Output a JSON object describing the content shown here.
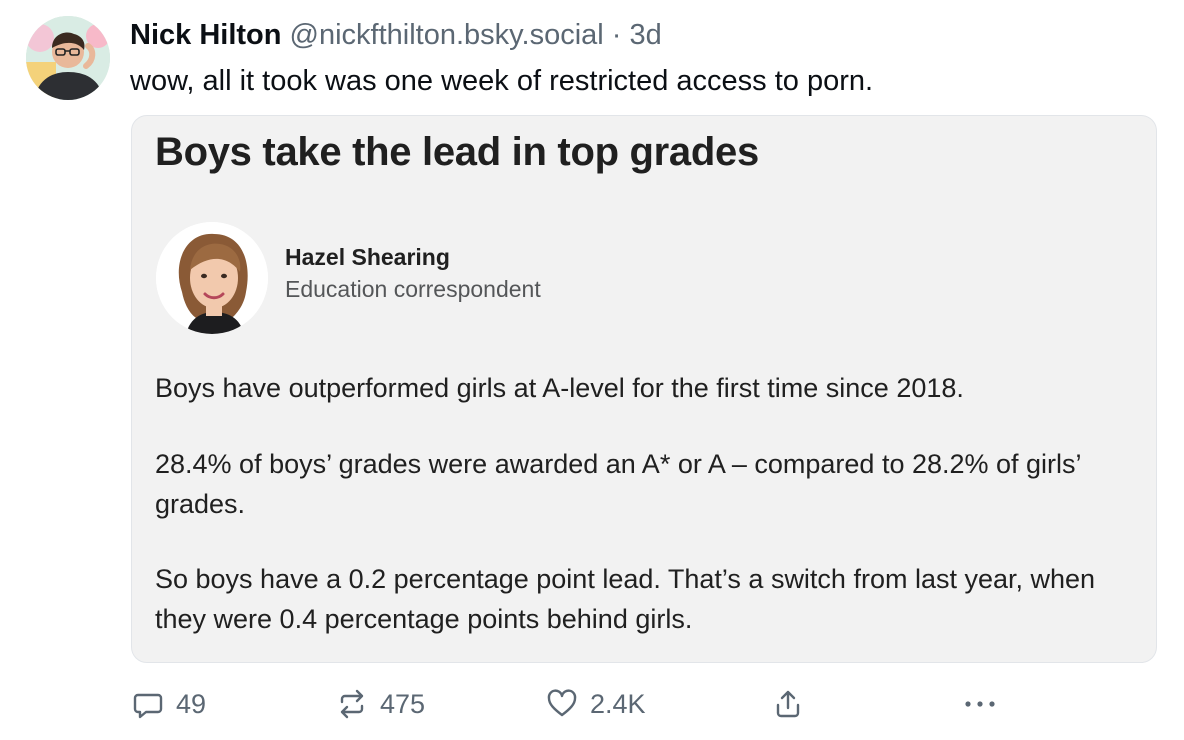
{
  "post": {
    "author_name": "Nick Hilton",
    "handle": "@nickfthilton.bsky.social",
    "separator": "·",
    "time": "3d",
    "text": "wow, all it took was one week of restricted access to porn."
  },
  "embed": {
    "title": "Boys take the lead in top grades",
    "reporter_name": "Hazel Shearing",
    "reporter_role": "Education correspondent",
    "paragraphs": [
      "Boys have outperformed girls at A-level for the first time since 2018.",
      "28.4% of boys’ grades were awarded an A* or A – compared to 28.2% of girls’ grades.",
      "So boys have a 0.2 percentage point lead. That’s a switch from last year, when they were 0.4 percentage points behind girls."
    ]
  },
  "actions": {
    "reply_count": "49",
    "repost_count": "475",
    "like_count": "2.4K",
    "icons": [
      "reply-icon",
      "repost-icon",
      "like-icon",
      "share-icon",
      "more-icon"
    ]
  },
  "colors": {
    "muted_text": "#5b6773",
    "card_background": "#f2f2f2",
    "card_border": "#e2e5e9"
  }
}
